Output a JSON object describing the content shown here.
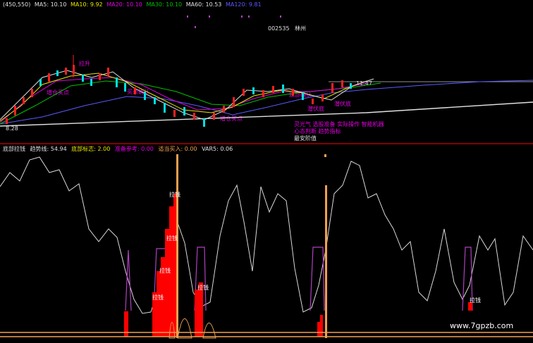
{
  "colors": {
    "background": "#000000",
    "divider": "#b00000",
    "ma5": "#e0e0e0",
    "ma10": "#e8e800",
    "ma20": "#e000e0",
    "ma30": "#00c000",
    "ma60": "#5a5aff",
    "candle_up": "#ff2020",
    "candle_down": "#00e0e0",
    "purple": "#b040c0",
    "orange": "#f0a050",
    "red_fill": "#ff0000",
    "white_line": "#ffffff"
  },
  "price_panel": {
    "header": {
      "range": "(450,550)",
      "ma5": "MA5: 10.10",
      "ma10": "MA10: 9.92",
      "ma20": "MA20: 10.10",
      "ma30": "MA30: 10.10",
      "ma60": "MA60: 10.53",
      "ma_extra": "MA120: 9.81"
    },
    "code": "002535",
    "name": "林州",
    "price_low": "8.28",
    "price_last": "11.47",
    "annotations": {
      "a1": "增仓买点",
      "a2": "增仓买点",
      "a3": "潜伏底",
      "a4": "潜伏底",
      "a5": "买点确认",
      "a6": "底部确认",
      "a7": "拉升"
    },
    "legend_lines": [
      "灵光气 选股准备 实际操作 智能机器",
      "心态判断 趋势指标",
      "最安阶值"
    ]
  },
  "indicator_panel": {
    "header": {
      "name": "底部拉钱",
      "trend": "趋势线: 54.94",
      "bottom": "底部标志: 2.00",
      "ref": "准备参考: 0.00",
      "buy": "适当买入: 0.00",
      "var": "VAR5: 0.06"
    },
    "signal_label": "拉钱"
  },
  "watermark": "www.7gpzb.com"
}
